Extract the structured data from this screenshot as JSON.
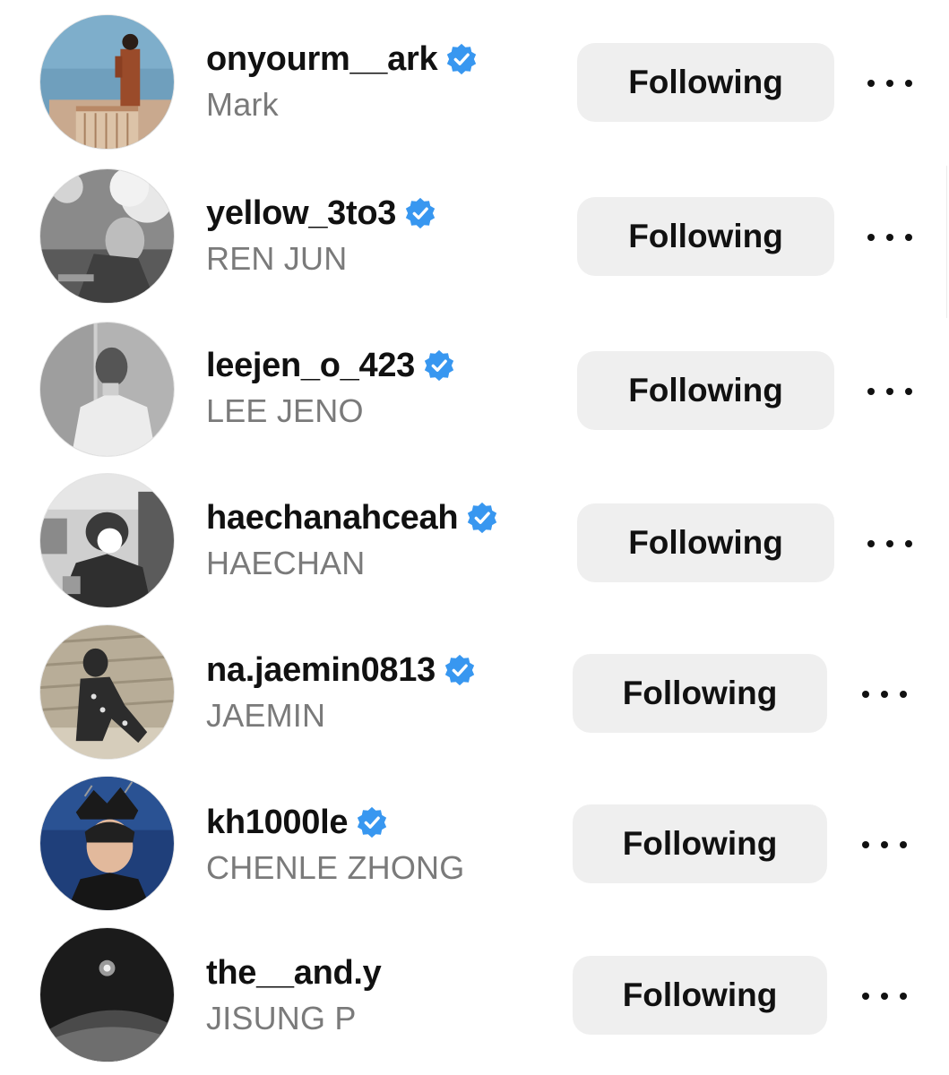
{
  "accent_verified_color": "#3897f0",
  "following_list": [
    {
      "handle": "onyourm__ark",
      "name": "Mark",
      "verified": true,
      "button_label": "Following",
      "avatar_icon": "avatar-photo"
    },
    {
      "handle": "yellow_3to3",
      "name": "REN JUN",
      "verified": true,
      "button_label": "Following",
      "avatar_icon": "avatar-photo"
    },
    {
      "handle": "leejen_o_423",
      "name": "LEE JENO",
      "verified": true,
      "button_label": "Following",
      "avatar_icon": "avatar-photo"
    },
    {
      "handle": "haechanahceah",
      "name": "HAECHAN",
      "verified": true,
      "button_label": "Following",
      "avatar_icon": "avatar-photo"
    },
    {
      "handle": "na.jaemin0813",
      "name": "JAEMIN",
      "verified": true,
      "button_label": "Following",
      "avatar_icon": "avatar-photo"
    },
    {
      "handle": "kh1000le",
      "name": "CHENLE ZHONG",
      "verified": true,
      "button_label": "Following",
      "avatar_icon": "avatar-photo"
    },
    {
      "handle": "the__and.y",
      "name": "JISUNG P",
      "verified": false,
      "button_label": "Following",
      "avatar_icon": "avatar-photo"
    }
  ],
  "more_options_icon": "more-horizontal-icon",
  "verified_icon": "verified-badge-icon"
}
